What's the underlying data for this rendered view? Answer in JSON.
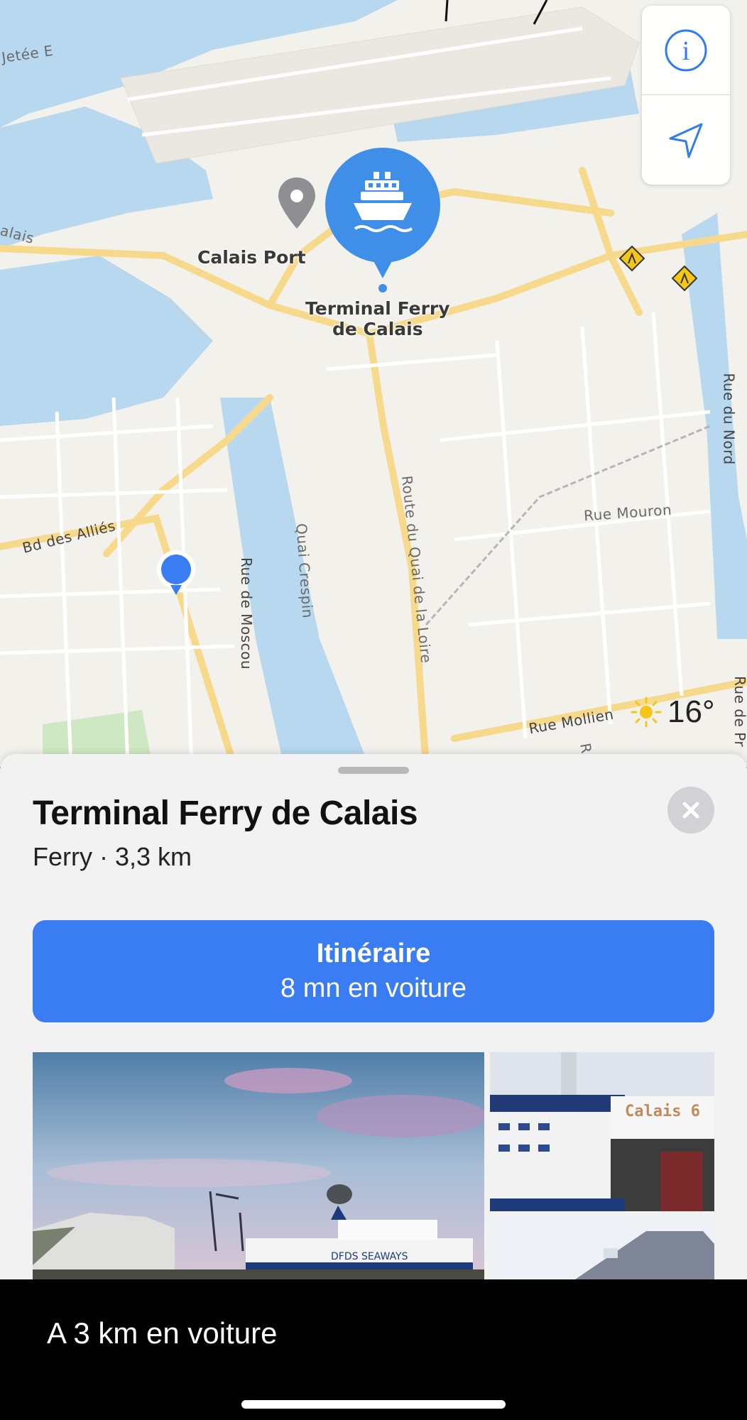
{
  "map": {
    "labels": {
      "jetee": "Jetée E",
      "calais_edge": "alais",
      "calais_port": "Calais Port",
      "terminal_line1": "Terminal Ferry",
      "terminal_line2": "de Calais",
      "bd_allies": "Bd des Alliés",
      "rue_moscou": "Rue de Moscou",
      "quai_crespin": "Quai Crespin",
      "route_loire": "Route du Quai de la Loire",
      "rue_mouron": "Rue Mouron",
      "rue_nord": "Rue du Nord",
      "rue_mollien": "Rue Mollien",
      "rue_de_pr": "Rue de Pr",
      "r_fragment": "R"
    },
    "controls": {
      "info_icon": "info-icon",
      "location_icon": "location-arrow-icon"
    },
    "weather": {
      "icon": "sun-icon",
      "temperature": "16°"
    },
    "colors": {
      "land": "#f3f1ec",
      "water": "#b8d8ef",
      "road": "#ffffff",
      "major_road": "#f6d98a",
      "accent": "#3a7df2",
      "park": "#cfe8c4"
    }
  },
  "sheet": {
    "title": "Terminal Ferry de Calais",
    "subtitle": "Ferry · 3,3 km",
    "directions": {
      "label": "Itinéraire",
      "detail": "8 mn en voiture"
    },
    "photos": {
      "main_caption": "DFDS SEAWAYS",
      "side_caption": "Calais 6"
    }
  },
  "caption": {
    "text": "A 3 km en voiture"
  }
}
